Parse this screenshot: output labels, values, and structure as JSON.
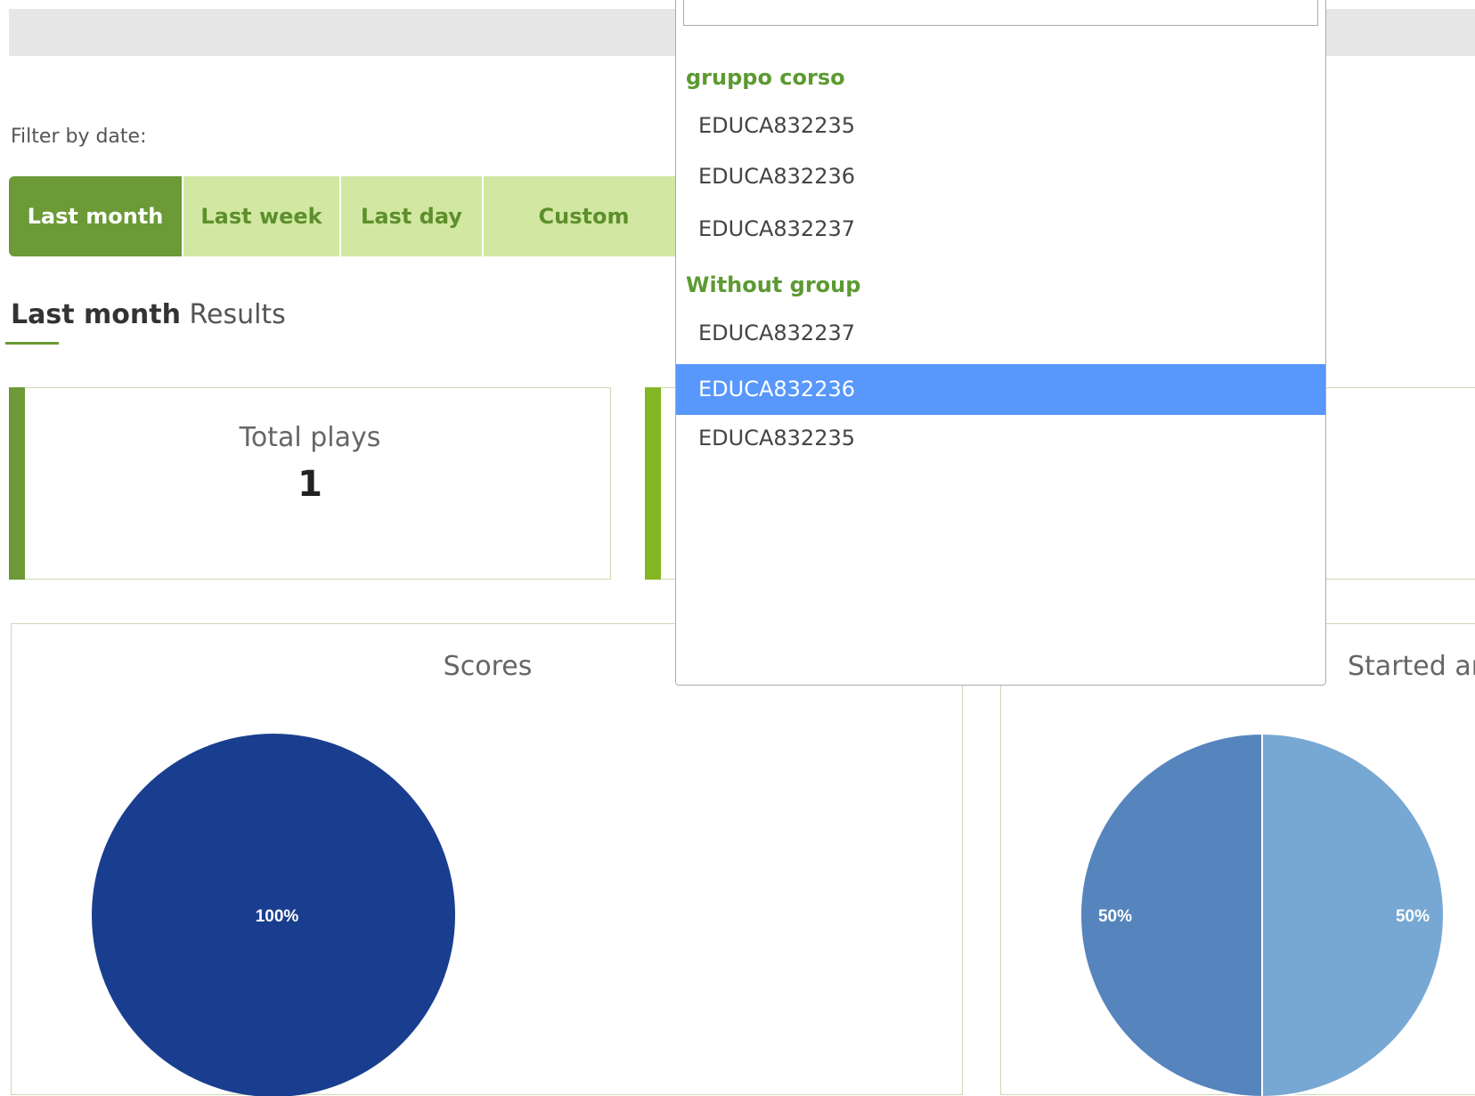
{
  "filter": {
    "label": "Filter by date:",
    "tabs": [
      {
        "label": "Last month",
        "active": true
      },
      {
        "label": "Last week",
        "active": false
      },
      {
        "label": "Last day",
        "active": false
      },
      {
        "label": "Custom",
        "active": false
      }
    ]
  },
  "results": {
    "period": "Last month",
    "suffix": "Results"
  },
  "stats": [
    {
      "title": "Total plays",
      "value": "1"
    }
  ],
  "dropdown": {
    "search_value": "",
    "groups": [
      {
        "label": "gruppo corso",
        "options": [
          "EDUCA832235",
          "EDUCA832236",
          "EDUCA832237"
        ]
      },
      {
        "label": "Without group",
        "options": [
          "EDUCA832237",
          "EDUCA832236",
          "EDUCA832235"
        ]
      }
    ],
    "selected": "EDUCA832236"
  },
  "charts": [
    {
      "title": "Scores"
    },
    {
      "title": "Started ar"
    }
  ],
  "colors": {
    "accent_green": "#6b9a36",
    "tab_light": "#d2e8a2",
    "highlight_blue": "#5897fb",
    "scores_pie": "#1a3e8f",
    "started_pie_left": "#5684bd",
    "started_pie_right": "#77a8d3"
  },
  "chart_data": [
    {
      "type": "pie",
      "title": "Scores",
      "slices": [
        {
          "value": 100,
          "label": "100%"
        }
      ]
    },
    {
      "type": "pie",
      "title": "Started ar",
      "slices": [
        {
          "value": 50,
          "label": "50%"
        },
        {
          "value": 50,
          "label": "50%"
        }
      ]
    }
  ]
}
